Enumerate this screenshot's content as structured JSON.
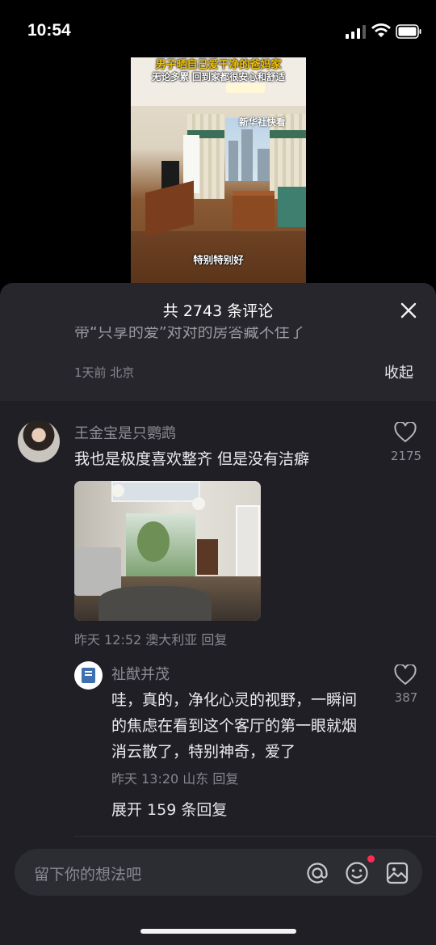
{
  "status_bar": {
    "time": "10:54"
  },
  "video": {
    "title": "男子晒自己爱干净的爸妈家",
    "subtitle": "无论多累 回到家都很安心和舒适",
    "watermark": "新华社快看",
    "caption": "特别特别好"
  },
  "comments_sheet": {
    "title": "共 2743 条评论",
    "close_icon": "close-icon",
    "previous_comment": {
      "cut_text": "带“只享的爱”对对的房答藏不住了",
      "meta": "1天前 北京",
      "collapse_label": "收起"
    },
    "comment": {
      "author": "王金宝是只鹦鹉",
      "text": "我也是极度喜欢整齐 但是没有洁癖",
      "likes": "2175",
      "meta": "昨天 12:52 澳大利亚 回复",
      "reply": {
        "author": "祉猷并茂",
        "text": "哇，真的，净化心灵的视野，一瞬间的焦虑在看到这个客厅的第一眼就烟消云散了，特别神奇，爱了",
        "likes": "387",
        "meta": "昨天 13:20 山东 回复"
      },
      "expand_label": "展开 159 条回复"
    },
    "input": {
      "placeholder": "留下你的想法吧",
      "icons": [
        "at-icon",
        "emoji-icon",
        "image-icon"
      ]
    }
  },
  "colors": {
    "sheet_bg": "#1f1f25",
    "header_bg": "#26262c",
    "notification_dot": "#fe2c55"
  }
}
